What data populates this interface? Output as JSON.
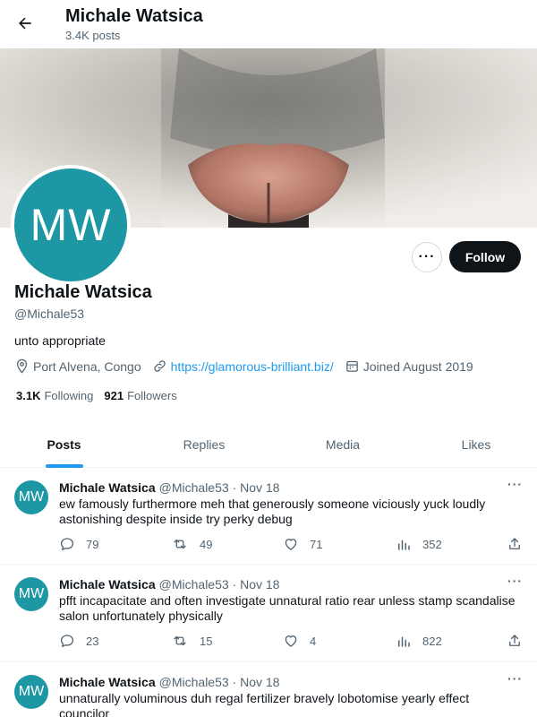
{
  "header": {
    "title": "Michale Watsica",
    "post_count": "3.4K posts"
  },
  "profile": {
    "initials": "MW",
    "name": "Michale Watsica",
    "handle": "@Michale53",
    "bio": "unto appropriate",
    "location": "Port Alvena, Congo",
    "website": "https://glamorous-brilliant.biz/",
    "joined": "Joined August 2019",
    "following_count": "3.1K",
    "following_label": "Following",
    "followers_count": "921",
    "followers_label": "Followers",
    "more_label": "···",
    "follow_label": "Follow"
  },
  "tabs": [
    {
      "label": "Posts",
      "active": true
    },
    {
      "label": "Replies",
      "active": false
    },
    {
      "label": "Media",
      "active": false
    },
    {
      "label": "Likes",
      "active": false
    }
  ],
  "posts": [
    {
      "initials": "MW",
      "name": "Michale Watsica",
      "meta": "@Michale53 · Nov 18",
      "text": "ew famously furthermore meh that generously someone viciously yuck loudly astonishing despite inside try perky debug",
      "replies": "79",
      "reposts": "49",
      "likes": "71",
      "views": "352",
      "more": "···"
    },
    {
      "initials": "MW",
      "name": "Michale Watsica",
      "meta": "@Michale53 · Nov 18",
      "text": "pfft incapacitate and often investigate unnatural ratio rear unless stamp scandalise salon unfortunately physically",
      "replies": "23",
      "reposts": "15",
      "likes": "4",
      "views": "822",
      "more": "···"
    },
    {
      "initials": "MW",
      "name": "Michale Watsica",
      "meta": "@Michale53 · Nov 18",
      "text": "unnaturally voluminous duh regal fertilizer bravely lobotomise yearly effect councilor",
      "replies": "",
      "reposts": "",
      "likes": "",
      "views": "",
      "more": "···"
    }
  ],
  "colors": {
    "accent": "#1d9bf0",
    "avatar": "#1d97a4",
    "text": "#0f1419",
    "muted": "#536471"
  }
}
